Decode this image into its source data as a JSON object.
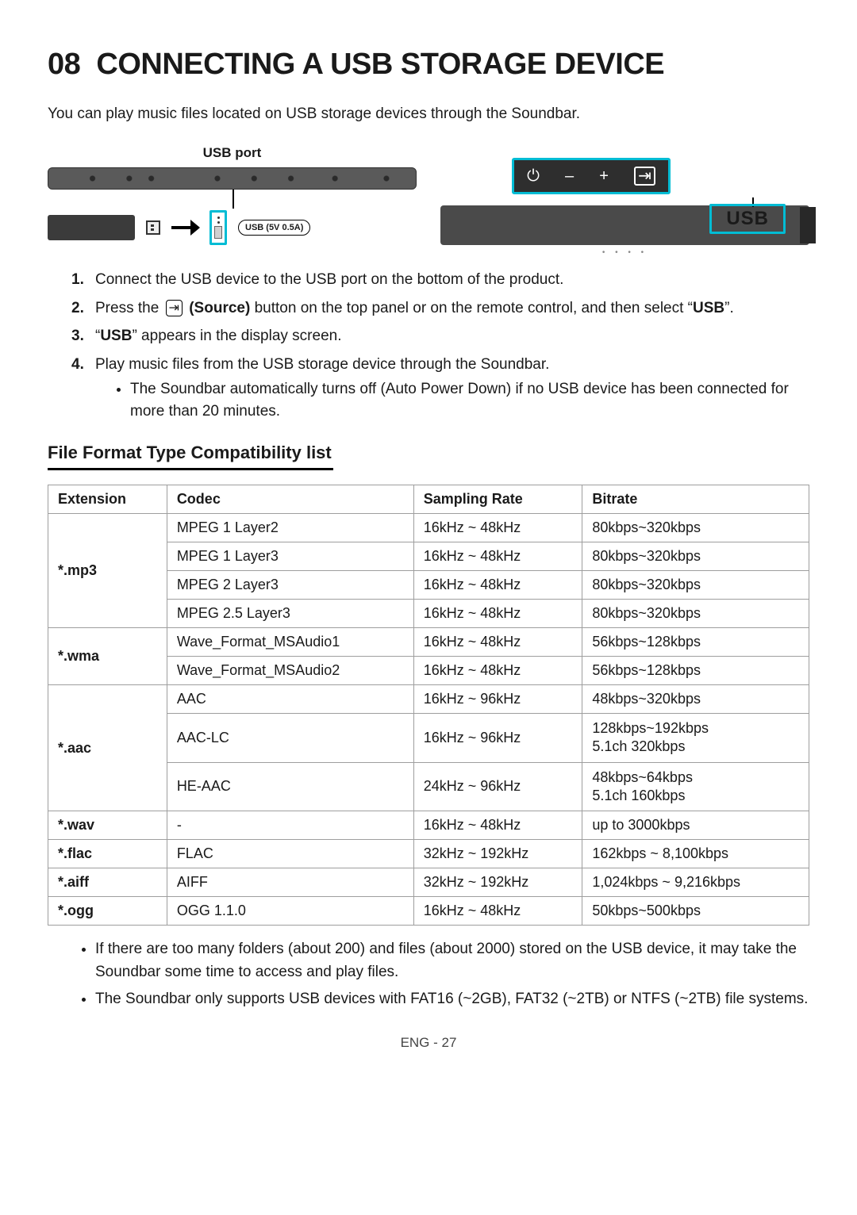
{
  "chapterNumber": "08",
  "chapterTitle": "CONNECTING A USB STORAGE DEVICE",
  "intro": "You can play music files located on USB storage devices through the Soundbar.",
  "diagram": {
    "usbPortLabel": "USB port",
    "usbCaption": "USB (5V 0.5A)",
    "controls": {
      "power": "⏻",
      "minus": "–",
      "plus": "+",
      "src": "⇥"
    },
    "displayText": "USB"
  },
  "steps": [
    {
      "text": "Connect the USB device to the USB port on the bottom of the product."
    },
    {
      "before": "Press the ",
      "sourceLabel": "(Source)",
      "after": " button on the top panel or on the remote control, and then select “",
      "boldEnd": "USB",
      "afterBold": "”."
    },
    {
      "before": "“",
      "bold": "USB",
      "after": "” appears in the display screen."
    },
    {
      "text": "Play music files from the USB storage device through the Soundbar.",
      "sub": [
        "The Soundbar automatically turns off (Auto Power Down) if no USB device has been connected for more than 20 minutes."
      ]
    }
  ],
  "subheading": "File Format Type Compatibility list",
  "table": {
    "headers": [
      "Extension",
      "Codec",
      "Sampling Rate",
      "Bitrate"
    ],
    "groups": [
      {
        "ext": "*.mp3",
        "rows": [
          {
            "codec": "MPEG 1 Layer2",
            "sr": "16kHz ~ 48kHz",
            "br": "80kbps~320kbps"
          },
          {
            "codec": "MPEG 1 Layer3",
            "sr": "16kHz ~ 48kHz",
            "br": "80kbps~320kbps"
          },
          {
            "codec": "MPEG 2 Layer3",
            "sr": "16kHz ~ 48kHz",
            "br": "80kbps~320kbps"
          },
          {
            "codec": "MPEG 2.5 Layer3",
            "sr": "16kHz ~ 48kHz",
            "br": "80kbps~320kbps"
          }
        ]
      },
      {
        "ext": "*.wma",
        "rows": [
          {
            "codec": "Wave_Format_MSAudio1",
            "sr": "16kHz ~ 48kHz",
            "br": "56kbps~128kbps"
          },
          {
            "codec": "Wave_Format_MSAudio2",
            "sr": "16kHz ~ 48kHz",
            "br": "56kbps~128kbps"
          }
        ]
      },
      {
        "ext": "*.aac",
        "rows": [
          {
            "codec": "AAC",
            "sr": "16kHz ~ 96kHz",
            "br": "48kbps~320kbps"
          },
          {
            "codec": "AAC-LC",
            "sr": "16kHz ~ 96kHz",
            "br": [
              "128kbps~192kbps",
              "5.1ch 320kbps"
            ]
          },
          {
            "codec": "HE-AAC",
            "sr": "24kHz ~ 96kHz",
            "br": [
              "48kbps~64kbps",
              "5.1ch 160kbps"
            ]
          }
        ]
      },
      {
        "ext": "*.wav",
        "rows": [
          {
            "codec": "-",
            "sr": "16kHz ~ 48kHz",
            "br": "up to 3000kbps"
          }
        ]
      },
      {
        "ext": "*.flac",
        "rows": [
          {
            "codec": "FLAC",
            "sr": "32kHz ~ 192kHz",
            "br": "162kbps ~ 8,100kbps"
          }
        ]
      },
      {
        "ext": "*.aiff",
        "rows": [
          {
            "codec": "AIFF",
            "sr": "32kHz ~ 192kHz",
            "br": "1,024kbps ~ 9,216kbps"
          }
        ]
      },
      {
        "ext": "*.ogg",
        "rows": [
          {
            "codec": "OGG 1.1.0",
            "sr": "16kHz ~ 48kHz",
            "br": "50kbps~500kbps"
          }
        ]
      }
    ]
  },
  "notes": [
    "If there are too many folders (about 200) and files (about 2000) stored on the USB device, it may take the Soundbar some time to access and play files.",
    "The Soundbar only supports USB devices with FAT16 (~2GB), FAT32 (~2TB) or NTFS (~2TB) file systems."
  ],
  "footer": "ENG - 27"
}
